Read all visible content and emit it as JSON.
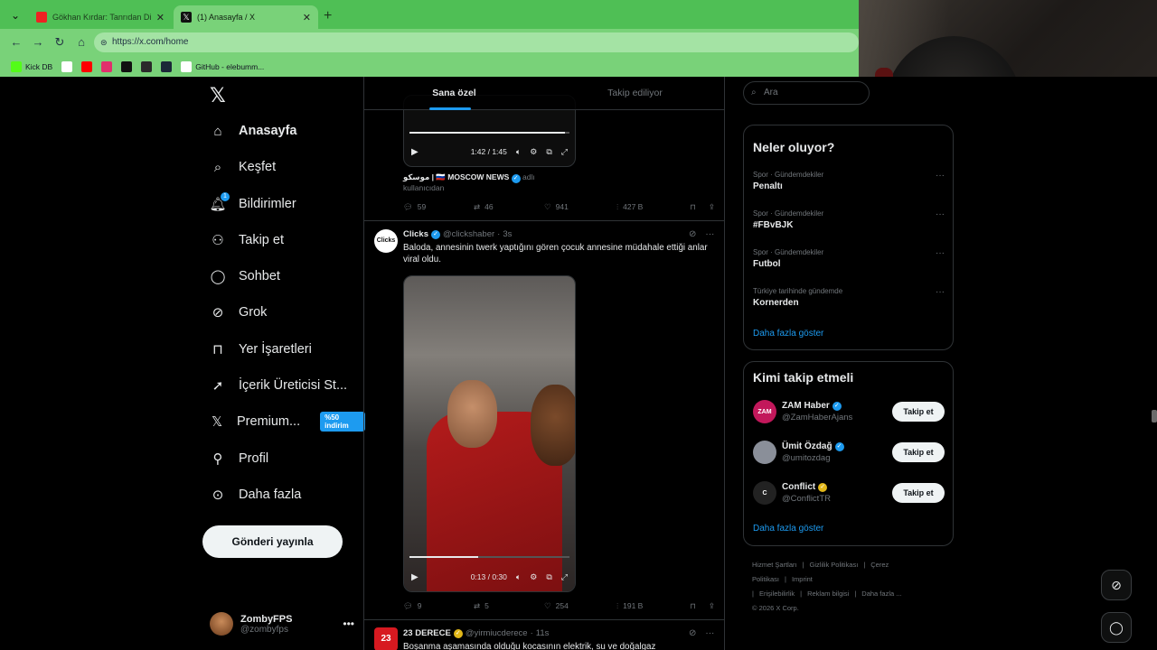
{
  "browser": {
    "tabs": [
      {
        "title": "Gökhan Kırdar: Tanrıdan Diledim (",
        "icon": "youtube-icon"
      },
      {
        "title": "(1) Anasayfa / X",
        "icon": "x-icon"
      }
    ],
    "url": "https://x.com/home",
    "bookmarks": [
      {
        "label": "Kick DB",
        "color": "#53fc18"
      },
      {
        "label": "",
        "color": "#ffffff"
      },
      {
        "label": "",
        "color": "#ff0000"
      },
      {
        "label": "",
        "color": "#e1306c"
      },
      {
        "label": "",
        "color": "#111111"
      },
      {
        "label": "",
        "color": "#2a2a2a"
      },
      {
        "label": "",
        "color": "#1b2838"
      },
      {
        "label": "GitHub - elebumm...",
        "color": "#ffffff"
      }
    ]
  },
  "nav": {
    "items": [
      {
        "label": "Anasayfa",
        "icon": "home-icon"
      },
      {
        "label": "Keşfet",
        "icon": "search-icon"
      },
      {
        "label": "Bildirimler",
        "icon": "bell-icon",
        "badge": "1"
      },
      {
        "label": "Takip et",
        "icon": "add-user-icon"
      },
      {
        "label": "Sohbet",
        "icon": "chat-icon"
      },
      {
        "label": "Grok",
        "icon": "grok-icon"
      },
      {
        "label": "Yer İşaretleri",
        "icon": "bookmark-icon"
      },
      {
        "label": "İçerik Üreticisi St...",
        "icon": "rocket-icon"
      },
      {
        "label": "Premium...",
        "icon": "x-icon",
        "promo": "%50 indirim"
      },
      {
        "label": "Profil",
        "icon": "person-icon"
      },
      {
        "label": "Daha fazla",
        "icon": "more-circle-icon"
      }
    ],
    "post_button": "Gönderi yayınla",
    "account": {
      "name": "ZombyFPS",
      "handle": "@zombyfps"
    }
  },
  "timeline": {
    "tabs": [
      "Sana özel",
      "Takip ediliyor"
    ],
    "tweet1": {
      "video_time": "1:42 / 1:45",
      "video_progress": 0.97,
      "source_text": "موسكو | 🇷🇺 MOSCOW NEWS",
      "source_suffix": "adlı",
      "source_line2": "kullanıcıdan",
      "replies": "59",
      "reposts": "46",
      "likes": "941",
      "views": "427 B"
    },
    "tweet2": {
      "name": "Clicks",
      "handle": "@clickshaber",
      "time": "3s",
      "text": "Baloda, annesinin twerk yaptığını gören çocuk annesine müdahale ettiği anlar viral oldu.",
      "avatar_text": "Clicks",
      "video_time": "0:13 / 0:30",
      "video_progress": 0.43,
      "replies": "9",
      "reposts": "5",
      "likes": "254",
      "views": "191 B"
    },
    "tweet3": {
      "name": "23 DERECE",
      "handle": "@yirmiucderece",
      "time": "11s",
      "text": "Boşanma aşamasında olduğu kocasının elektrik, su ve doğalgaz",
      "avatar_text": "23"
    }
  },
  "right": {
    "search_placeholder": "Ara",
    "trends_title": "Neler oluyor?",
    "trends": [
      {
        "category": "Spor · Gündemdekiler",
        "name": "Penaltı"
      },
      {
        "category": "Spor · Gündemdekiler",
        "name": "#FBvBJK"
      },
      {
        "category": "Spor · Gündemdekiler",
        "name": "Futbol"
      },
      {
        "category": "Türkiye tarihinde gündemde",
        "name": "Kornerden"
      }
    ],
    "trends_more": "Daha fazla göster",
    "who_title": "Kimi takip etmeli",
    "who": [
      {
        "name": "ZAM Haber",
        "handle": "@ZamHaberAjans",
        "avatar_text": "ZAM",
        "color": "#c2185b",
        "badge": "blue"
      },
      {
        "name": "Ümit Özdağ",
        "handle": "@umitozdag",
        "avatar_text": "",
        "color": "#8a8f99",
        "badge": "blue"
      },
      {
        "name": "Conflict",
        "handle": "@ConflictTR",
        "avatar_text": "C",
        "color": "#222222",
        "badge": "gold"
      }
    ],
    "follow_label": "Takip et",
    "who_more": "Daha fazla göster",
    "footer": [
      "Hizmet Şartları",
      "|",
      "Gizlilik Politikası",
      "|",
      "Çerez Politikası",
      "|",
      "Imprint",
      "|",
      "Erişilebilirlik",
      "|",
      "Reklam bilgisi",
      "|",
      "Daha fazla ...",
      "© 2026 X Corp."
    ]
  }
}
